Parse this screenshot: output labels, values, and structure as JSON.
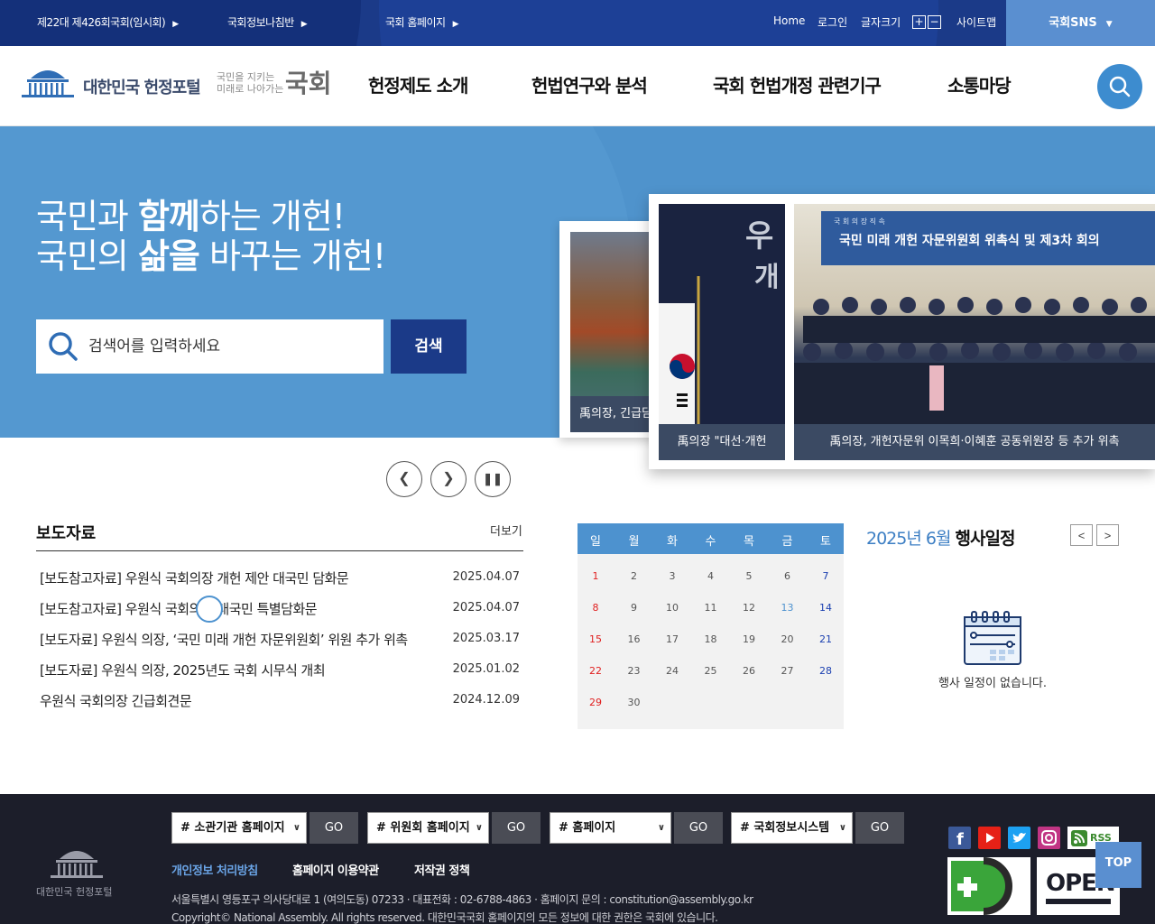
{
  "topbar": {
    "links": [
      "제22대 제426회국회(임시회)",
      "국회정보나침반",
      "국회 홈페이지"
    ],
    "home": "Home",
    "login": "로그인",
    "font_size": "글자크기",
    "font_plus": "+",
    "font_minus": "−",
    "sitemap": "사이트맵",
    "sns": "국회SNS"
  },
  "header": {
    "logo_title": "대한민국 헌정포털",
    "logo_slogan_1": "국민을 지키는",
    "logo_slogan_2": "미래로 나아가는",
    "logo_big": "국회",
    "nav": [
      "헌정제도 소개",
      "헌법연구와 분석",
      "국회 헌법개정 관련기구",
      "소통마당"
    ]
  },
  "hero": {
    "line1_a": "국민과 ",
    "line1_b": "함께",
    "line1_c": "하는 개헌!",
    "line2_a": "국민의 ",
    "line2_b": "삶을",
    "line2_c": " 바꾸는 개헌!",
    "search_placeholder": "검색어를 입력하세요",
    "search_button": "검색"
  },
  "slides": {
    "back_caption": "禹의장, 긴급담",
    "mid_caption": "禹의장 \"대선·개헌",
    "main_caption": "禹의장, 개헌자문위 이목희·이혜훈 공동위원장 등 추가 위촉",
    "main_banner": "국민 미래 개헌 자문위원회 위촉식 및 제3차 회의",
    "main_banner_small": "국 회 의 장  직 속",
    "mid_sign_1": "우",
    "mid_sign_2": "개"
  },
  "press": {
    "title": "보도자료",
    "more": "더보기",
    "items": [
      {
        "title": "[보도참고자료] 우원식 국회의장 개헌 제안 대국민 담화문",
        "date": "2025.04.07"
      },
      {
        "title": "[보도참고자료] 우원식 국회의장 대국민 특별담화문",
        "date": "2025.04.07"
      },
      {
        "title": "[보도자료] 우원식 의장, ‘국민 미래 개헌 자문위원회’ 위원 추가 위촉",
        "date": "2025.03.17"
      },
      {
        "title": "[보도자료] 우원식 의장, 2025년도 국회 시무식 개최",
        "date": "2025.01.02"
      },
      {
        "title": "우원식 국회의장 긴급회견문",
        "date": "2024.12.09"
      }
    ]
  },
  "calendar": {
    "weekdays": [
      "일",
      "월",
      "화",
      "수",
      "목",
      "금",
      "토"
    ],
    "days": [
      "1",
      "2",
      "3",
      "4",
      "5",
      "6",
      "7",
      "8",
      "9",
      "10",
      "11",
      "12",
      "13",
      "14",
      "15",
      "16",
      "17",
      "18",
      "19",
      "20",
      "21",
      "22",
      "23",
      "24",
      "25",
      "26",
      "27",
      "28",
      "29",
      "30"
    ],
    "today": "13",
    "colors": {
      "sunday": "#e02020",
      "saturday": "#1a3fb0",
      "weekday": "#555555",
      "accent": "#4d92cf"
    }
  },
  "events": {
    "month_label": "2025년 6월",
    "title": "행사일정",
    "prev": "<",
    "next": ">",
    "empty": "행사 일정이 없습니다."
  },
  "footer": {
    "logo_text": "대한민국 헌정포털",
    "selects": [
      "# 소관기관 홈페이지",
      "# 위원회 홈페이지",
      "# 홈페이지",
      "# 국회정보시스템"
    ],
    "go": "GO",
    "links": [
      "개인정보 처리방침",
      "홈페이지 이용약관",
      "저작권 정책"
    ],
    "address": "서울특별시 영등포구 의사당대로 1 (여의도동) 07233  · 대표전화 : 02-6788-4863  · 홈페이지 문의 : constitution@assembly.go.kr",
    "copyright": "Copyright© National Assembly. All rights reserved. 대한민국국회 홈페이지의 모든 정보에 대한 권한은 국회에 있습니다.",
    "rss": "RSS",
    "open_badge": "OPEN",
    "top": "TOP"
  }
}
